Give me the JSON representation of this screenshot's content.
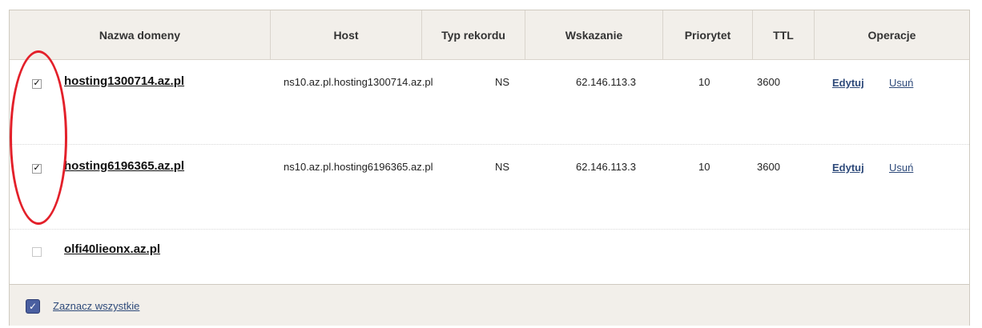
{
  "table": {
    "headers": [
      "Nazwa domeny",
      "Host",
      "Typ rekordu",
      "Wskazanie",
      "Priorytet",
      "TTL",
      "Operacje"
    ],
    "rows": [
      {
        "checked": true,
        "check_glyph": "✓",
        "domain": "hosting1300714.az.pl",
        "host": "ns10.az.pl.hosting1300714.az.pl",
        "type": "NS",
        "target": "62.146.113.3",
        "priority": "10",
        "ttl": "3600",
        "edit": "Edytuj",
        "delete": "Usuń"
      },
      {
        "checked": true,
        "check_glyph": "✓",
        "domain": "hosting6196365.az.pl",
        "host": "ns10.az.pl.hosting6196365.az.pl",
        "type": "NS",
        "target": "62.146.113.3",
        "priority": "10",
        "ttl": "3600",
        "edit": "Edytuj",
        "delete": "Usuń"
      },
      {
        "checked": false,
        "check_glyph": "",
        "domain": "olfi40lieonx.az.pl"
      }
    ]
  },
  "footer": {
    "select_all_label": "Zaznacz wszystkie",
    "select_all_glyph": "✓"
  },
  "colors": {
    "header_bg": "#f2efea",
    "link": "#2e4a7a",
    "annotation": "#e3202a"
  },
  "annotation": {
    "shape": "ellipse",
    "target": "row checkboxes"
  }
}
